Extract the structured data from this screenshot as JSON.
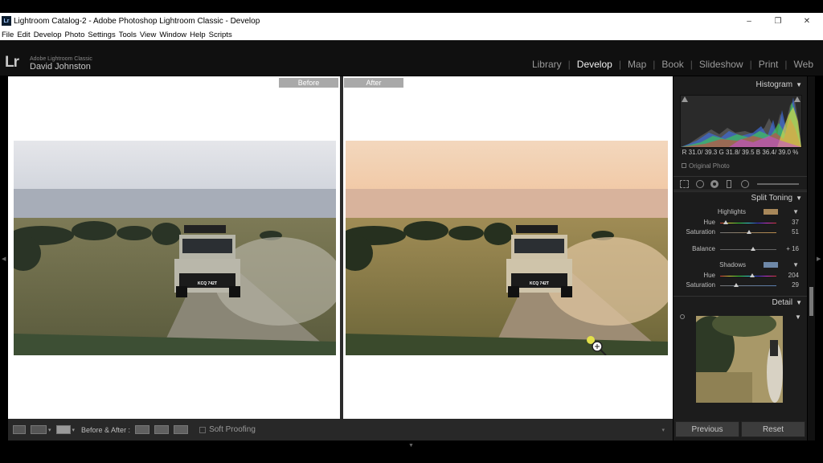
{
  "window": {
    "title": "Lightroom Catalog-2 - Adobe Photoshop Lightroom Classic - Develop",
    "app_icon": "Lr",
    "controls": [
      "–",
      "❐",
      "✕"
    ]
  },
  "menu": [
    "File",
    "Edit",
    "Develop",
    "Photo",
    "Settings",
    "Tools",
    "View",
    "Window",
    "Help",
    "Scripts"
  ],
  "identity": {
    "logo": "Lr",
    "app_name": "Adobe Lightroom Classic",
    "user": "David Johnston"
  },
  "modules": [
    "Library",
    "Develop",
    "Map",
    "Book",
    "Slideshow",
    "Print",
    "Web"
  ],
  "active_module": "Develop",
  "view": {
    "before_label": "Before",
    "after_label": "After",
    "plate": "KCQ 742T"
  },
  "toolbar": {
    "before_after_label": "Before & After :",
    "soft_proofing": "Soft Proofing"
  },
  "panel": {
    "histogram": {
      "title": "Histogram",
      "r_label": "R",
      "r_val": "31.0/ 39.3",
      "g_label": "G",
      "g_val": "31.8/ 39.5",
      "b_label": "B",
      "b_val": "36.4/ 39.0",
      "unit": "%",
      "original_photo": "Original Photo"
    },
    "split_toning": {
      "title": "Split Toning",
      "highlights_label": "Highlights",
      "highlights_hue_label": "Hue",
      "highlights_hue": "37",
      "highlights_hue_fraction": 0.1,
      "highlights_sat_label": "Saturation",
      "highlights_sat": "51",
      "highlights_sat_fraction": 0.51,
      "balance_label": "Balance",
      "balance": "+ 16",
      "balance_fraction": 0.58,
      "shadows_label": "Shadows",
      "shadows_hue_label": "Hue",
      "shadows_hue": "204",
      "shadows_hue_fraction": 0.57,
      "shadows_sat_label": "Saturation",
      "shadows_sat": "29",
      "shadows_sat_fraction": 0.29,
      "highlight_color": "#a8885a",
      "shadow_color": "#6e88a8"
    },
    "detail": {
      "title": "Detail"
    }
  },
  "buttons": {
    "previous": "Previous",
    "reset": "Reset"
  }
}
